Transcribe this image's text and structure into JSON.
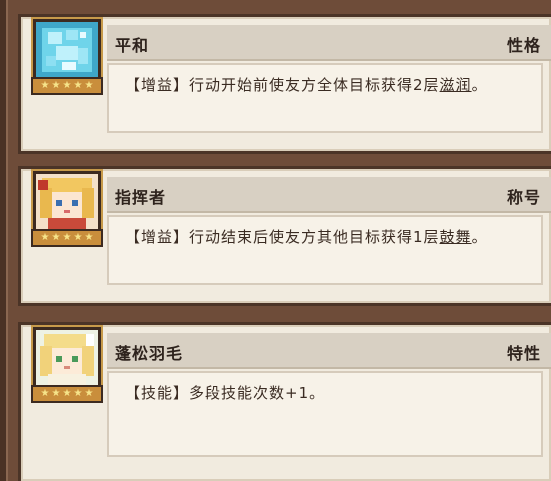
{
  "cards": [
    {
      "title": "平和",
      "tag": "性格",
      "desc_prefix": "【增益】行动开始前使友方全体目标获得2层",
      "desc_keyword": "滋润",
      "desc_suffix": "。",
      "stars": 5,
      "portrait_icon": "crystal-icon"
    },
    {
      "title": "指挥者",
      "tag": "称号",
      "desc_prefix": "【增益】行动结束后使友方其他目标获得1层",
      "desc_keyword": "鼓舞",
      "desc_suffix": "。",
      "stars": 5,
      "portrait_icon": "character-portrait-icon"
    },
    {
      "title": "蓬松羽毛",
      "tag": "特性",
      "desc_prefix": "【技能】多段技能次数+1。",
      "desc_keyword": "",
      "desc_suffix": "",
      "stars": 5,
      "portrait_icon": "character-portrait-icon"
    }
  ]
}
